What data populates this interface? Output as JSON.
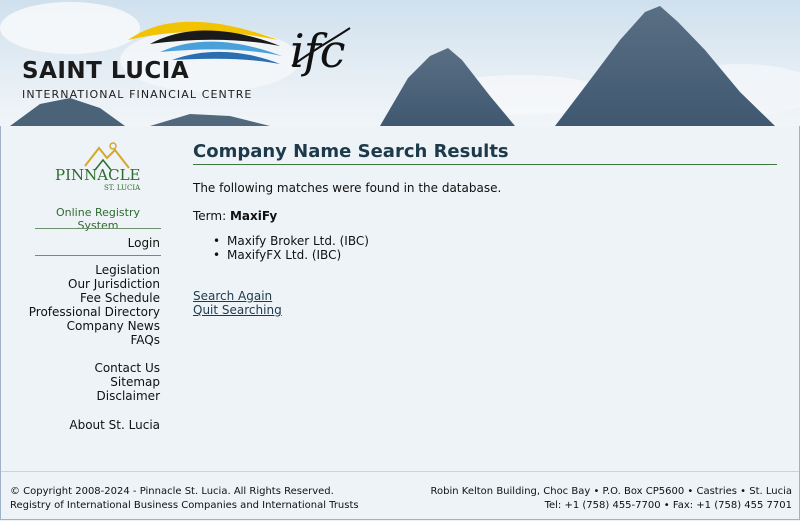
{
  "header": {
    "brand_title": "SAINT LUCIA",
    "brand_subtitle": "INTERNATIONAL FINANCIAL CENTRE",
    "brand_mark": "ifc"
  },
  "sidebar": {
    "logo_text": "PINNACLE",
    "logo_subtext": "ST. LUCIA",
    "system_label": "Online Registry System",
    "login": "Login",
    "links_group1": [
      "Legislation",
      "Our Jurisdiction",
      "Fee Schedule",
      "Professional Directory",
      "Company News",
      "FAQs"
    ],
    "links_group2": [
      "Contact Us",
      "Sitemap",
      "Disclaimer"
    ],
    "links_group3": [
      "About St. Lucia"
    ]
  },
  "main": {
    "title": "Company Name Search Results",
    "intro": "The following matches were found in the database.",
    "term_label": "Term:",
    "term_value": "MaxiFy",
    "results": [
      "Maxify Broker Ltd. (IBC)",
      "MaxifyFX Ltd. (IBC)"
    ],
    "search_again": "Search Again",
    "quit_searching": "Quit Searching"
  },
  "footer": {
    "copyright": "© Copyright 2008-2024 - Pinnacle St. Lucia. All Rights Reserved.",
    "registry": "Registry of International Business Companies and International Trusts",
    "address": "Robin Kelton Building, Choc Bay • P.O. Box CP5600 • Castries • St. Lucia",
    "phone": "Tel: +1 (758) 455-7700 • Fax: +1 (758) 455 7701"
  },
  "colors": {
    "title": "#1d3a4a",
    "accent_green": "#2e6b2e",
    "background": "#eef3f7"
  }
}
